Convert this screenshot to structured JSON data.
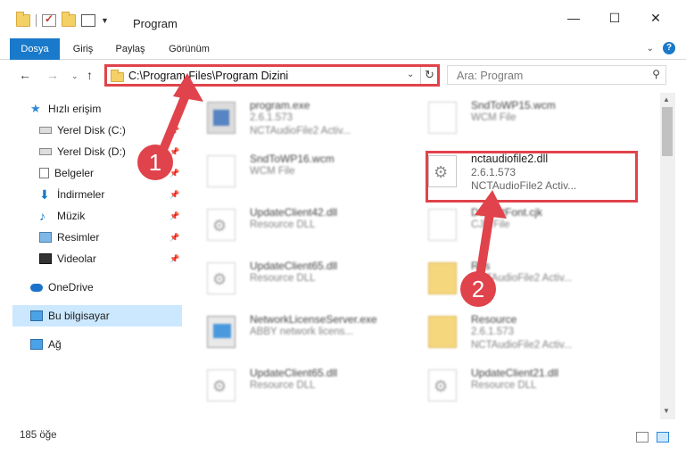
{
  "window": {
    "title": "Program",
    "minimize": "—",
    "maximize": "☐",
    "close": "✕"
  },
  "ribbon": {
    "tabs": [
      "Dosya",
      "Giriş",
      "Paylaş",
      "Görünüm"
    ],
    "collapse": "⌄",
    "help": "?"
  },
  "nav": {
    "back": "←",
    "forward": "→",
    "recent": "⌄",
    "up": "↑",
    "address": "C:\\Program Files\\Program Dizini",
    "address_dropdown": "⌄",
    "refresh": "↻",
    "search_placeholder": "Ara: Program",
    "search_icon": "⚲"
  },
  "sidebar": {
    "items": [
      {
        "label": "Hızlı erişim",
        "icon": "star-icon"
      },
      {
        "label": "Yerel Disk (C:)",
        "icon": "drive-icon"
      },
      {
        "label": "Yerel Disk (D:)",
        "icon": "drive-icon"
      },
      {
        "label": "Belgeler",
        "icon": "documents-icon"
      },
      {
        "label": "İndirmeler",
        "icon": "download-icon"
      },
      {
        "label": "Müzik",
        "icon": "music-icon"
      },
      {
        "label": "Resimler",
        "icon": "pictures-icon"
      },
      {
        "label": "Videolar",
        "icon": "videos-icon"
      },
      {
        "label": "OneDrive",
        "icon": "cloud-icon"
      },
      {
        "label": "Bu bilgisayar",
        "icon": "computer-icon"
      },
      {
        "label": "Ağ",
        "icon": "network-icon"
      }
    ],
    "pin": "📌"
  },
  "files": [
    {
      "name": "program.exe",
      "line2": "2.6.1.573",
      "line3": "NCTAudioFile2 Activ..."
    },
    {
      "name": "SndToWP15.wcm",
      "line2": "WCM File",
      "line3": ""
    },
    {
      "name": "SndToWP16.wcm",
      "line2": "WCM File",
      "line3": ""
    },
    {
      "name": "nctaudiofile2.dll",
      "line2": "2.6.1.573",
      "line3": "NCTAudioFile2 Activ..."
    },
    {
      "name": "UpdateClient42.dll",
      "line2": "Resource DLL",
      "line3": ""
    },
    {
      "name": "DefaultFont.cjk",
      "line2": "CJK File",
      "line3": ""
    },
    {
      "name": "UpdateClient65.dll",
      "line2": "Resource DLL",
      "line3": ""
    },
    {
      "name": "Res",
      "line2": "NCTAudioFile2 Activ...",
      "line3": ""
    },
    {
      "name": "NetworkLicenseServer.exe",
      "line2": "ABBY network licens...",
      "line3": ""
    },
    {
      "name": "Resource",
      "line2": "2.6.1.573",
      "line3": "NCTAudioFile2 Activ..."
    },
    {
      "name": "UpdateClient65.dll",
      "line2": "Resource DLL",
      "line3": ""
    },
    {
      "name": "UpdateClient21.dll",
      "line2": "Resource DLL",
      "line3": ""
    }
  ],
  "annotations": {
    "badge1": "1",
    "badge2": "2",
    "color": "#e0434b"
  },
  "status": {
    "count": "185 öğe"
  },
  "colors": {
    "accent": "#1979ca",
    "selection": "#cce8ff"
  }
}
